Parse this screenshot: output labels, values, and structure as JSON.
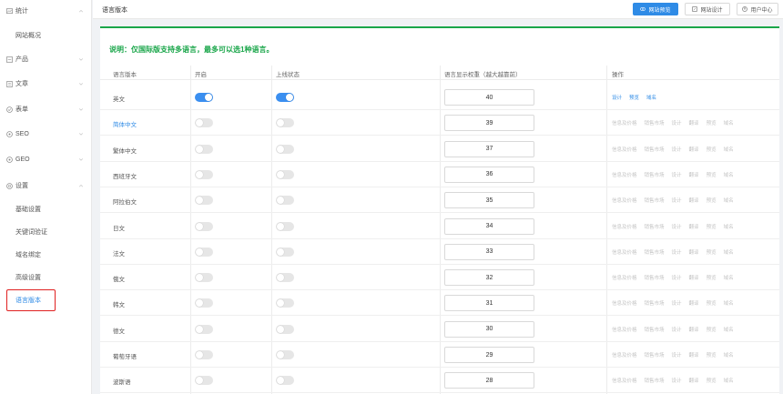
{
  "sidebar": {
    "menus": [
      {
        "label": "统计",
        "icon": "chart-icon"
      },
      {
        "label": "产品",
        "icon": "box-icon"
      },
      {
        "label": "文章",
        "icon": "document-icon"
      },
      {
        "label": "表单",
        "icon": "form-icon"
      },
      {
        "label": "SEO",
        "icon": "seo-icon"
      },
      {
        "label": "GEO",
        "icon": "geo-icon"
      },
      {
        "label": "设置",
        "icon": "gear-icon"
      }
    ],
    "stats_sub": "网站概况",
    "settings_subs": [
      "基础设置",
      "关键词验证",
      "域名绑定",
      "高级设置",
      "语言版本"
    ]
  },
  "topbar": {
    "title": "语言版本",
    "buttons": [
      "网站预览",
      "网站设计",
      "用户中心"
    ]
  },
  "notice": "说明：仅国际版支持多语言，最多可以选1种语言。",
  "table": {
    "headers": [
      "语言版本",
      "开启",
      "上线状态",
      "语言显示权重（越大越靠前）",
      "操作"
    ],
    "rows": [
      {
        "lang": "英文",
        "enabled": true,
        "online": true,
        "weight": "40",
        "ops": [
          "设计",
          "预览",
          "域名"
        ]
      },
      {
        "lang": "简体中文",
        "enabled": false,
        "online": false,
        "weight": "39",
        "ops": [
          "信息及价格",
          "销售市场",
          "设计",
          "翻译",
          "预览",
          "域名"
        ]
      },
      {
        "lang": "繁体中文",
        "enabled": false,
        "online": false,
        "weight": "37",
        "ops": [
          "信息及价格",
          "销售市场",
          "设计",
          "翻译",
          "预览",
          "域名"
        ]
      },
      {
        "lang": "西班牙文",
        "enabled": false,
        "online": false,
        "weight": "36",
        "ops": [
          "信息及价格",
          "销售市场",
          "设计",
          "翻译",
          "预览",
          "域名"
        ]
      },
      {
        "lang": "阿拉伯文",
        "enabled": false,
        "online": false,
        "weight": "35",
        "ops": [
          "信息及价格",
          "销售市场",
          "设计",
          "翻译",
          "预览",
          "域名"
        ]
      },
      {
        "lang": "日文",
        "enabled": false,
        "online": false,
        "weight": "34",
        "ops": [
          "信息及价格",
          "销售市场",
          "设计",
          "翻译",
          "预览",
          "域名"
        ]
      },
      {
        "lang": "法文",
        "enabled": false,
        "online": false,
        "weight": "33",
        "ops": [
          "信息及价格",
          "销售市场",
          "设计",
          "翻译",
          "预览",
          "域名"
        ]
      },
      {
        "lang": "俄文",
        "enabled": false,
        "online": false,
        "weight": "32",
        "ops": [
          "信息及价格",
          "销售市场",
          "设计",
          "翻译",
          "预览",
          "域名"
        ]
      },
      {
        "lang": "韩文",
        "enabled": false,
        "online": false,
        "weight": "31",
        "ops": [
          "信息及价格",
          "销售市场",
          "设计",
          "翻译",
          "预览",
          "域名"
        ]
      },
      {
        "lang": "德文",
        "enabled": false,
        "online": false,
        "weight": "30",
        "ops": [
          "信息及价格",
          "销售市场",
          "设计",
          "翻译",
          "预览",
          "域名"
        ]
      },
      {
        "lang": "葡萄牙语",
        "enabled": false,
        "online": false,
        "weight": "29",
        "ops": [
          "信息及价格",
          "销售市场",
          "设计",
          "翻译",
          "预览",
          "域名"
        ]
      },
      {
        "lang": "波斯语",
        "enabled": false,
        "online": false,
        "weight": "28",
        "ops": [
          "信息及价格",
          "销售市场",
          "设计",
          "翻译",
          "预览",
          "域名"
        ]
      }
    ]
  },
  "colors": {
    "accent": "#2f8be6",
    "notice": "#1aa64a",
    "highlight": "#e02020"
  }
}
